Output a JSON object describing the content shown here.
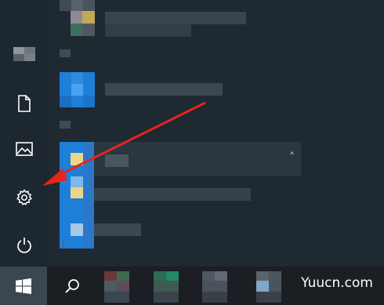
{
  "start_menu": {
    "rail": {
      "items": [
        {
          "name": "user-avatar"
        },
        {
          "name": "documents-icon"
        },
        {
          "name": "pictures-icon"
        },
        {
          "name": "settings-icon"
        },
        {
          "name": "power-icon"
        }
      ]
    },
    "expanded_row_chevron": "˄"
  },
  "taskbar": {
    "start_icon": "windows-logo-icon",
    "search_icon": "search-icon"
  },
  "watermark": "Yuucn.com",
  "annotation": {
    "type": "red-arrow",
    "points_to": "settings-icon",
    "color": "#e3261c"
  },
  "colors": {
    "menu_bg": "#1e2931",
    "taskbar_bg": "#1b1e23",
    "accent_blue": "#1e7fd8",
    "arrow_red": "#e3261c"
  }
}
